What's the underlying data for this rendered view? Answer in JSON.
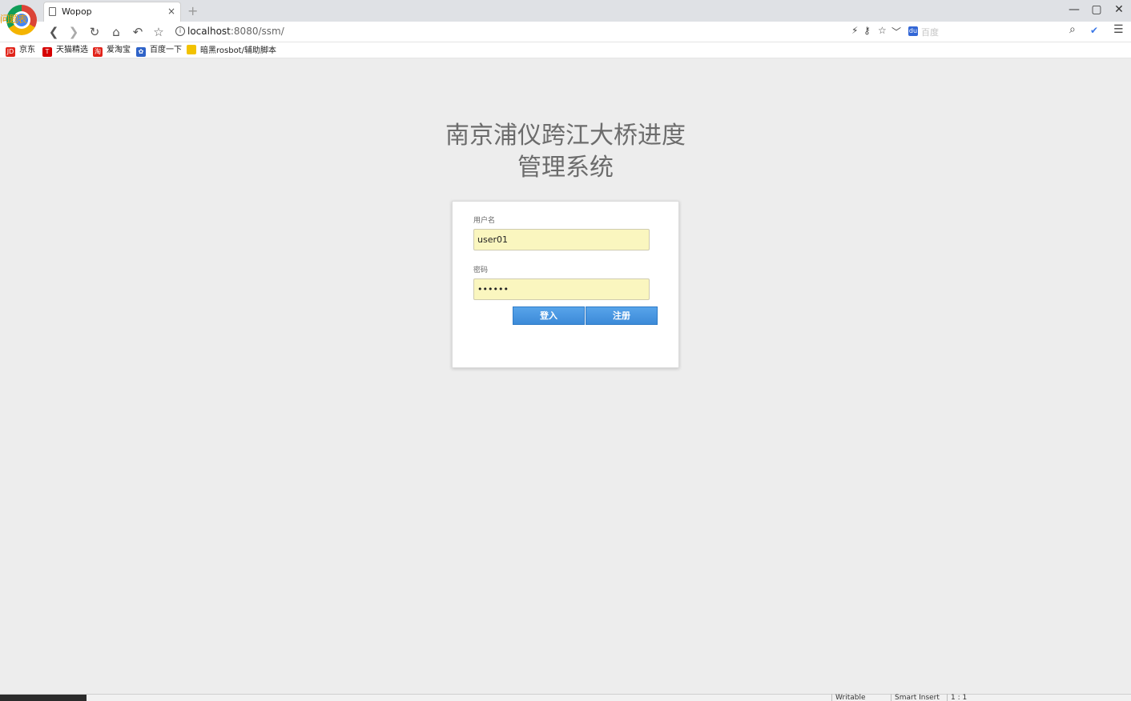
{
  "browser": {
    "logo_overlay": "问题表",
    "tab": {
      "title": "Wopop",
      "close": "×"
    },
    "new_tab": "+",
    "window_controls": {
      "minimize": "—",
      "maximize": "▢",
      "close": "✕"
    },
    "nav": {
      "back": "❮",
      "forward": "❯",
      "reload": "↻",
      "home": "⌂",
      "undo": "↶",
      "favorite": "☆"
    },
    "url": {
      "info": "i",
      "host": "localhost",
      "path": ":8080/ssm/"
    },
    "tools": {
      "flash": "⚡",
      "key": "⚷",
      "star": "☆",
      "dropdown": "﹀"
    },
    "search": {
      "engine_icon": "du",
      "placeholder": "百度",
      "magnifier": "⌕",
      "extension": "✔",
      "menu": "☰"
    },
    "bookmarks": [
      {
        "label": "京东",
        "icon": "JD",
        "color": "#e1251b"
      },
      {
        "label": "天猫精选",
        "icon": "T",
        "color": "#d60000"
      },
      {
        "label": "爱淘宝",
        "icon": "淘",
        "color": "#e2231a"
      },
      {
        "label": "百度一下",
        "icon": "✿",
        "color": "#2f63c8"
      },
      {
        "label": "暗黑rosbot/辅助脚本",
        "icon": "",
        "color": "#f2c200"
      }
    ]
  },
  "login": {
    "title_line1": "南京浦仪跨江大桥进度",
    "title_line2": "管理系统",
    "username_label": "用户名",
    "username_value": "user01",
    "password_label": "密码",
    "password_value": "123456",
    "login_button": "登入",
    "register_button": "注册"
  },
  "status_bar": {
    "writable": "Writable",
    "insert_mode": "Smart Insert",
    "position": "1 : 1"
  }
}
